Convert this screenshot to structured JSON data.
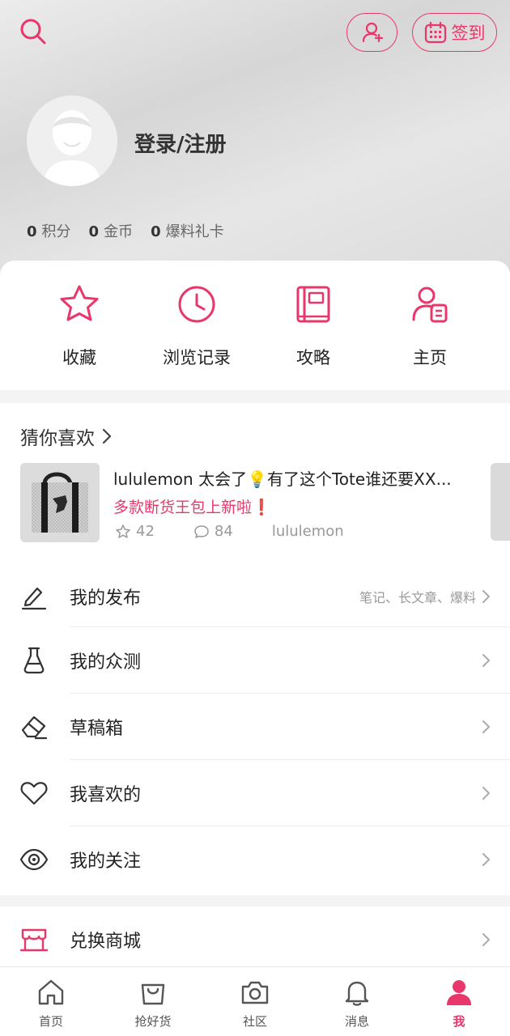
{
  "header": {
    "checkin_label": "签到",
    "login_text": "登录/注册",
    "stats": [
      {
        "value": "0",
        "label": "积分"
      },
      {
        "value": "0",
        "label": "金币"
      },
      {
        "value": "0",
        "label": "爆料礼卡"
      }
    ]
  },
  "quick_actions": [
    {
      "label": "收藏",
      "icon": "star-icon"
    },
    {
      "label": "浏览记录",
      "icon": "clock-icon"
    },
    {
      "label": "攻略",
      "icon": "book-icon"
    },
    {
      "label": "主页",
      "icon": "profile-card-icon"
    }
  ],
  "recommend": {
    "title": "猜你喜欢",
    "post": {
      "title": "lululemon 太会了💡有了这个Tote谁还要XX...",
      "subtitle": "多款断货王包上新啦❗",
      "likes": "42",
      "comments": "84",
      "author": "lululemon"
    }
  },
  "menu": [
    {
      "label": "我的发布",
      "hint": "笔记、长文章、爆料",
      "icon": "pen-icon"
    },
    {
      "label": "我的众测",
      "hint": "",
      "icon": "flask-icon"
    },
    {
      "label": "草稿箱",
      "hint": "",
      "icon": "eraser-icon"
    },
    {
      "label": "我喜欢的",
      "hint": "",
      "icon": "heart-icon"
    },
    {
      "label": "我的关注",
      "hint": "",
      "icon": "eye-icon"
    }
  ],
  "shop": {
    "label": "兑换商城",
    "icon": "store-icon"
  },
  "tabs": [
    {
      "label": "首页",
      "icon": "home-icon"
    },
    {
      "label": "抢好货",
      "icon": "bag-icon"
    },
    {
      "label": "社区",
      "icon": "camera-icon"
    },
    {
      "label": "消息",
      "icon": "bell-icon"
    },
    {
      "label": "我",
      "icon": "person-icon",
      "active": true
    }
  ],
  "colors": {
    "accent": "#e8386b",
    "text": "#222222",
    "muted": "#999999"
  }
}
